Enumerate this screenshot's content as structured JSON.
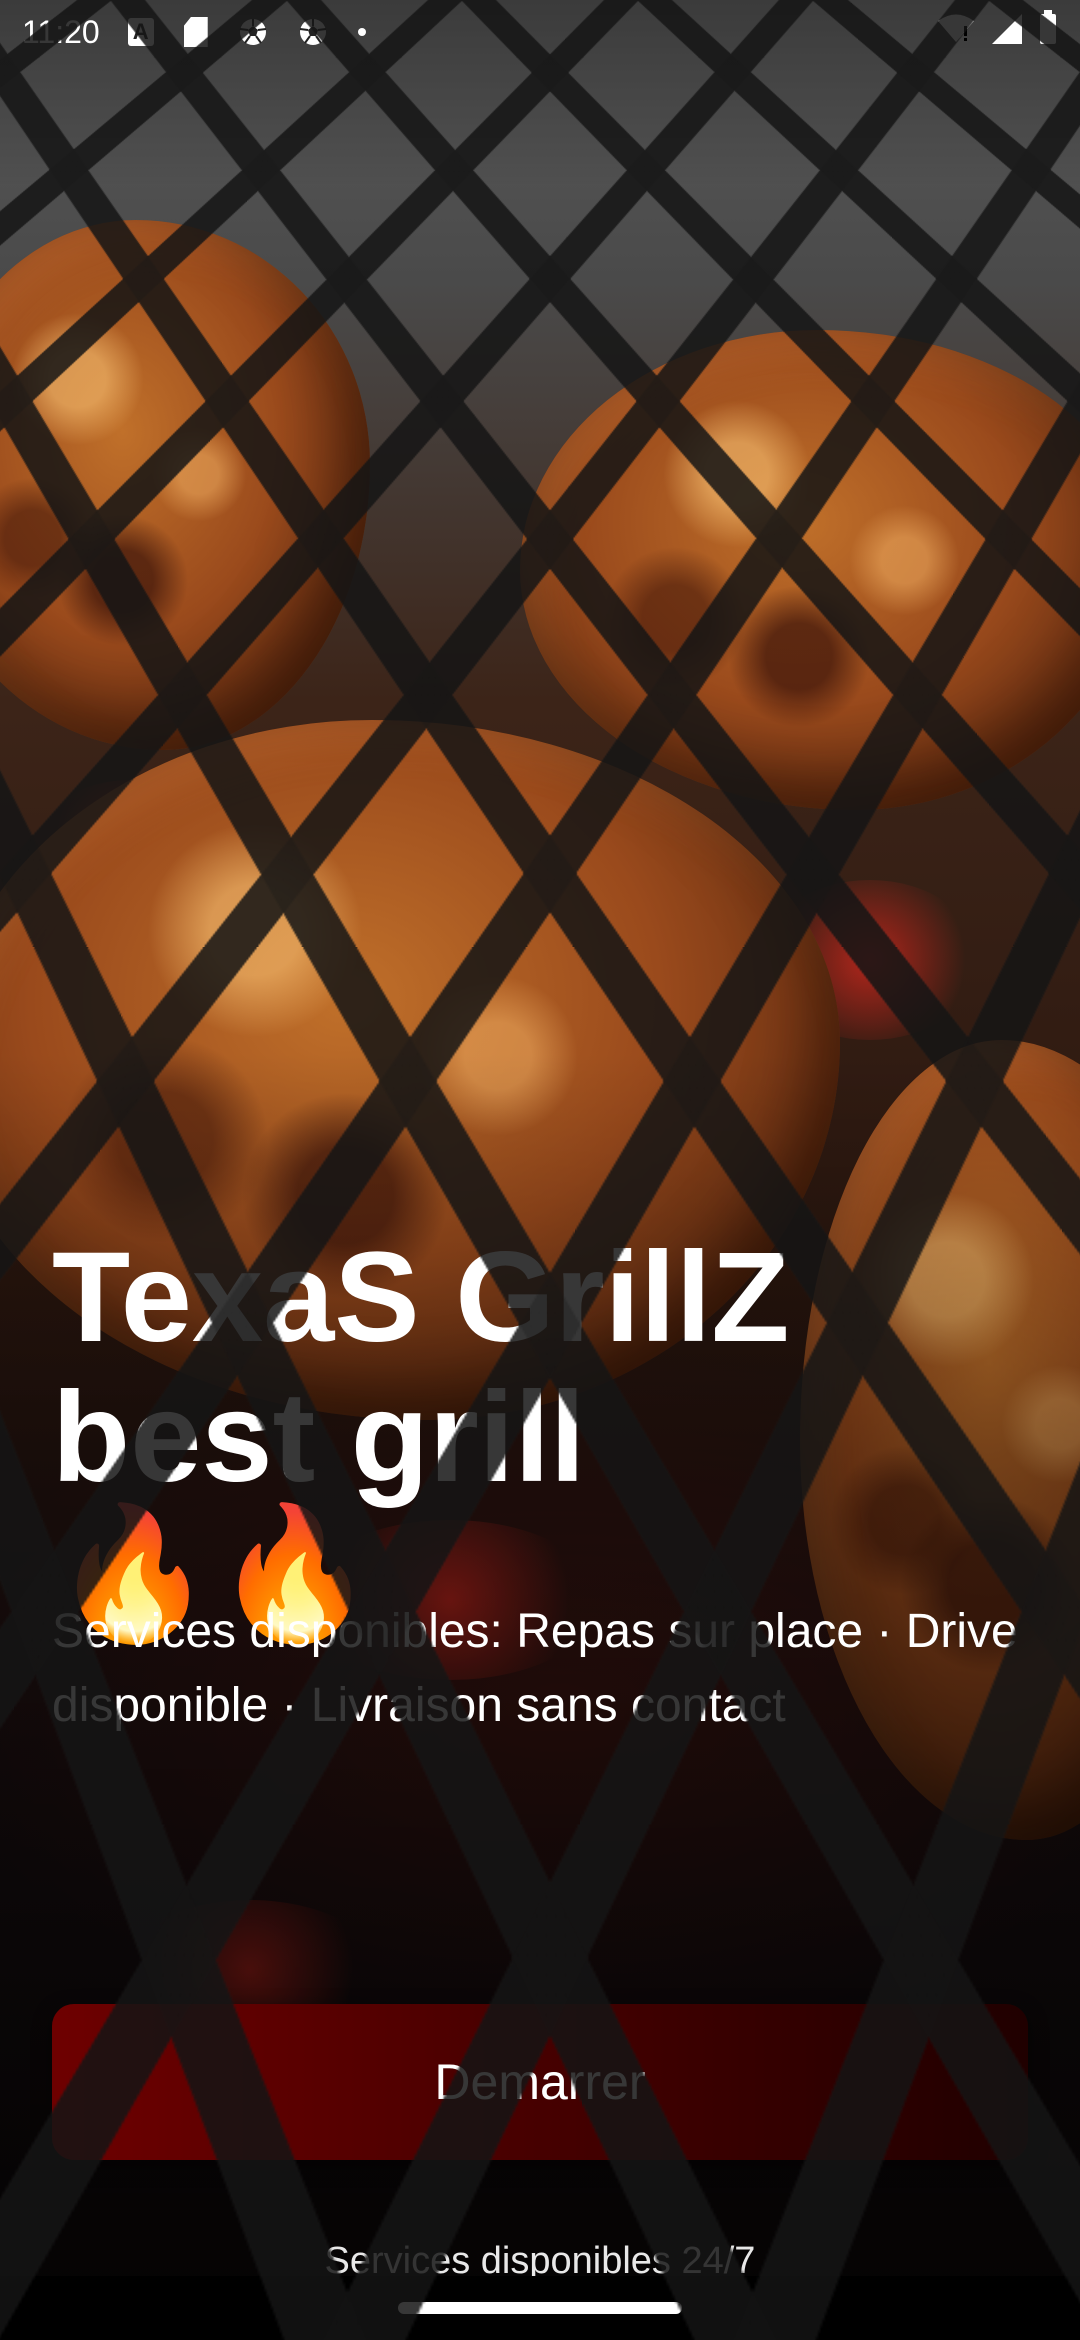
{
  "status_bar": {
    "time": "11:20",
    "left_icons": [
      "a-icon",
      "sd-card-icon",
      "soccer-ball-icon",
      "soccer-ball-icon",
      "dot-icon"
    ],
    "right_icons": [
      "wifi-icon",
      "signal-icon",
      "battery-icon"
    ]
  },
  "hero": {
    "title_line1": "TexaS GrillZ",
    "title_line2": "best grill ",
    "emoji": "🔥🔥",
    "services": "Services disponibles: Repas sur place · Drive disponible · Livraison sans contact"
  },
  "cta": {
    "label": "Demarrer",
    "color_start": "#6e0000",
    "color_end": "#200000"
  },
  "footer": {
    "note": "Services disponibles 24/7"
  }
}
